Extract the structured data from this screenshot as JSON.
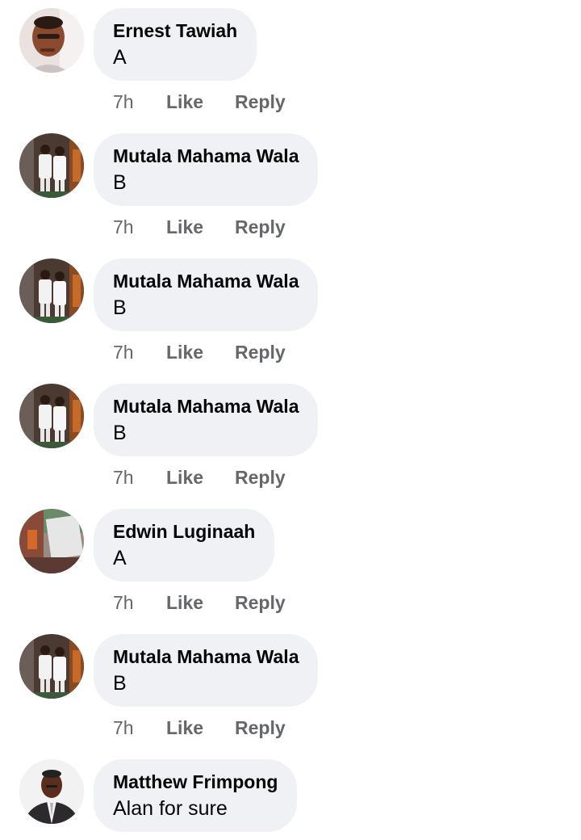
{
  "comments": [
    {
      "author": "Ernest Tawiah",
      "text": "A",
      "time": "7h",
      "like_label": "Like",
      "reply_label": "Reply",
      "avatar": "portrait-selfie"
    },
    {
      "author": "Mutala Mahama Wala",
      "text": "B",
      "time": "7h",
      "like_label": "Like",
      "reply_label": "Reply",
      "avatar": "two-men-white-outfits"
    },
    {
      "author": "Mutala Mahama Wala",
      "text": "B",
      "time": "7h",
      "like_label": "Like",
      "reply_label": "Reply",
      "avatar": "two-men-white-outfits"
    },
    {
      "author": "Mutala Mahama Wala",
      "text": "B",
      "time": "7h",
      "like_label": "Like",
      "reply_label": "Reply",
      "avatar": "two-men-white-outfits"
    },
    {
      "author": "Edwin Luginaah",
      "text": "A",
      "time": "7h",
      "like_label": "Like",
      "reply_label": "Reply",
      "avatar": "room-interior"
    },
    {
      "author": "Mutala Mahama Wala",
      "text": "B",
      "time": "7h",
      "like_label": "Like",
      "reply_label": "Reply",
      "avatar": "two-men-white-outfits"
    },
    {
      "author": "Matthew Frimpong",
      "text": "Alan for sure",
      "avatar": "man-in-suit-portrait"
    }
  ],
  "colors": {
    "bubble": "#f0f1f5",
    "author": "#050505",
    "meta": "#65676b"
  }
}
